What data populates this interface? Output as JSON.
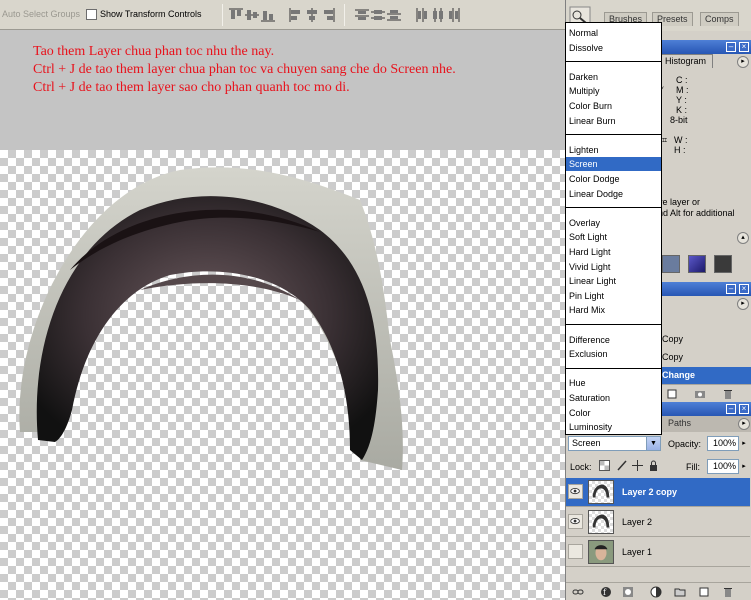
{
  "options_bar": {
    "auto_select_label": "Auto Select Groups",
    "show_transform_label": "Show Transform Controls",
    "show_transform_checked": false
  },
  "palette_well": {
    "tabs": [
      "Brushes",
      "Presets",
      "Comps"
    ]
  },
  "canvas": {
    "instructions": [
      "Tao them Layer chua phan toc nhu the nay.",
      "Ctrl + J de tao them layer chua phan toc va chuyen sang che do Screen nhe.",
      "Ctrl + J de tao them layer sao cho phan quanh toc mo di."
    ],
    "text_color": "#e8121c"
  },
  "info_palette": {
    "tab": "Histogram",
    "labels": [
      "C :",
      "M :",
      "Y :",
      "K :"
    ],
    "bit_depth": "8-bit",
    "size_labels": [
      "W :",
      "H :"
    ],
    "hint_lines": [
      "ve layer or",
      "nd Alt for additional"
    ]
  },
  "history_palette": {
    "states": [
      "Copy",
      "Copy",
      "Change"
    ],
    "selected_index": 2
  },
  "blend_menu": {
    "selected": "Screen",
    "groups": [
      [
        "Normal",
        "Dissolve"
      ],
      [
        "Darken",
        "Multiply",
        "Color Burn",
        "Linear Burn"
      ],
      [
        "Lighten",
        "Screen",
        "Color Dodge",
        "Linear Dodge"
      ],
      [
        "Overlay",
        "Soft Light",
        "Hard Light",
        "Vivid Light",
        "Linear Light",
        "Pin Light",
        "Hard Mix"
      ],
      [
        "Difference",
        "Exclusion"
      ],
      [
        "Hue",
        "Saturation",
        "Color",
        "Luminosity"
      ]
    ]
  },
  "layers_palette": {
    "tab_paths": "Paths",
    "blend_mode": "Screen",
    "opacity_label": "Opacity:",
    "opacity_value": "100%",
    "lock_label": "Lock:",
    "fill_label": "Fill:",
    "fill_value": "100%",
    "layers": [
      {
        "name": "Layer 2 copy",
        "selected": true,
        "visible": true
      },
      {
        "name": "Layer 2",
        "selected": false,
        "visible": true
      },
      {
        "name": "Layer 1",
        "selected": false,
        "visible": false
      }
    ]
  },
  "colors": {
    "selection_blue": "#316ac5",
    "title_blue": "#2756b4",
    "panel_gray": "#d4d0c8"
  }
}
